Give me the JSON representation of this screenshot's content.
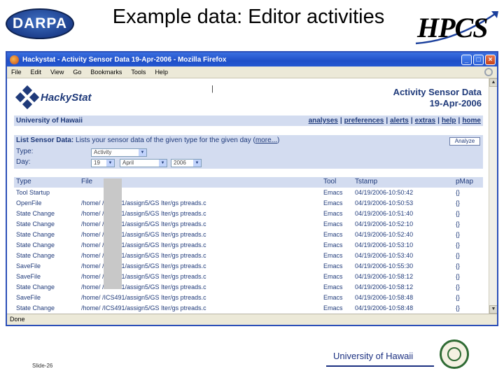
{
  "slide": {
    "title": "Example data: Editor activities",
    "darpa_logo": "DARPA",
    "hpcs_logo": "HPCS",
    "slide_number": "Slide-26",
    "footer_university": "University of Hawaii"
  },
  "browser": {
    "window_title": "Hackystat - Activity Sensor Data 19-Apr-2006 - Mozilla Firefox",
    "menu": [
      "File",
      "Edit",
      "View",
      "Go",
      "Bookmarks",
      "Tools",
      "Help"
    ],
    "status": "Done"
  },
  "page": {
    "logo_text": "HackyStat",
    "heading_line1": "Activity Sensor Data",
    "heading_line2": "19-Apr-2006",
    "university": "University of Hawaii",
    "nav": [
      "analyses",
      "preferences",
      "alerts",
      "extras",
      "help",
      "home"
    ],
    "form": {
      "title_bold": "List Sensor Data:",
      "title_rest": " Lists your sensor data of the given type for the given day (",
      "more_link": "more...",
      "title_end": ")",
      "type_label": "Type:",
      "type_value": "Activity",
      "day_label": "Day:",
      "day_value": "19",
      "month_value": "April",
      "year_value": "2006",
      "analyze_button": "Analyze"
    },
    "table": {
      "headers": [
        "Type",
        "File",
        "Tool",
        "Tstamp",
        "pMap"
      ],
      "rows": [
        [
          "Tool Startup",
          "",
          "Emacs",
          "04/19/2006-10:50:42",
          "{}"
        ],
        [
          "OpenFile",
          "/home/      /ICS491/assign5/GS Iter/gs  ptreads.c",
          "Emacs",
          "04/19/2006-10:50:53",
          "{}"
        ],
        [
          "State Change",
          "/home/      /ICS491/assign5/GS Iter/gs  ptreads.c",
          "Emacs",
          "04/19/2006-10:51:40",
          "{}"
        ],
        [
          "State Change",
          "/home/      /ICS491/assign5/GS Iter/gs  ptreads.c",
          "Emacs",
          "04/19/2006-10:52:10",
          "{}"
        ],
        [
          "State Change",
          "/home/      /ICS491/assign5/GS Iter/gs  ptreads.c",
          "Emacs",
          "04/19/2006-10:52:40",
          "{}"
        ],
        [
          "State Change",
          "/home/      /ICS491/assign5/GS Iter/gs  ptreads.c",
          "Emacs",
          "04/19/2006-10:53:10",
          "{}"
        ],
        [
          "State Change",
          "/home/      /ICS491/assign5/GS Iter/gs  ptreads.c",
          "Emacs",
          "04/19/2006-10:53:40",
          "{}"
        ],
        [
          "SaveFile",
          "/home/      /ICS491/assign5/GS Iter/gs  ptreads.c",
          "Emacs",
          "04/19/2006-10:55:30",
          "{}"
        ],
        [
          "SaveFile",
          "/home/      /ICS491/assign5/GS Iter/gs  ptreads.c",
          "Emacs",
          "04/19/2006-10:58:12",
          "{}"
        ],
        [
          "State Change",
          "/home/      /ICS491/assign5/GS Iter/gs  ptreads.c",
          "Emacs",
          "04/19/2006-10:58:12",
          "{}"
        ],
        [
          "SaveFile",
          "/home/      /ICS491/assign5/GS Iter/gs  ptreads.c",
          "Emacs",
          "04/19/2006-10:58:48",
          "{}"
        ],
        [
          "State Change",
          "/home/      /ICS491/assign5/GS Iter/gs  ptreads.c",
          "Emacs",
          "04/19/2006-10:58:48",
          "{}"
        ]
      ]
    }
  }
}
